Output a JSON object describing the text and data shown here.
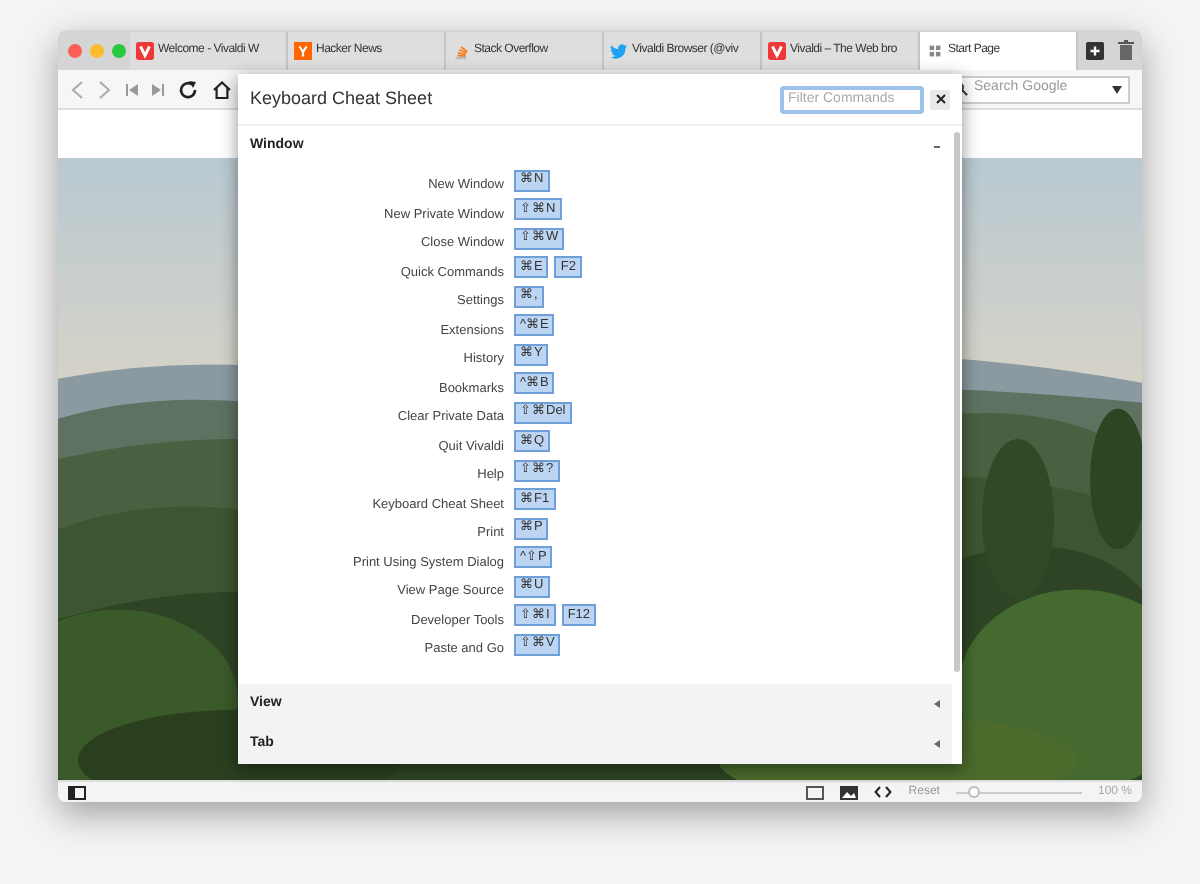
{
  "tabs": [
    {
      "title": "Welcome - Vivaldi W",
      "kind": "vivaldi",
      "selected": false
    },
    {
      "title": "Hacker News",
      "kind": "hn",
      "selected": false
    },
    {
      "title": "Stack Overflow",
      "kind": "stack",
      "selected": false
    },
    {
      "title": "Vivaldi Browser (@viv",
      "kind": "bird",
      "selected": false
    },
    {
      "title": "Vivaldi – The Web bro",
      "kind": "vivaldi",
      "selected": false
    },
    {
      "title": "Start Page",
      "kind": "grid",
      "selected": true
    }
  ],
  "search": {
    "placeholder": "Search Google"
  },
  "dialog": {
    "title": "Keyboard Cheat Sheet",
    "filter": {
      "placeholder": "Filter Commands"
    },
    "sections": [
      {
        "name": "Window",
        "expanded": true,
        "shortcuts": [
          {
            "label": "New Window",
            "keys": [
              "⌘N"
            ]
          },
          {
            "label": "New Private Window",
            "keys": [
              "⇧⌘N"
            ]
          },
          {
            "label": "Close Window",
            "keys": [
              "⇧⌘W"
            ]
          },
          {
            "label": "Quick Commands",
            "keys": [
              "⌘E",
              "F2"
            ]
          },
          {
            "label": "Settings",
            "keys": [
              "⌘,"
            ]
          },
          {
            "label": "Extensions",
            "keys": [
              "^⌘E"
            ]
          },
          {
            "label": "History",
            "keys": [
              "⌘Y"
            ]
          },
          {
            "label": "Bookmarks",
            "keys": [
              "^⌘B"
            ]
          },
          {
            "label": "Clear Private Data",
            "keys": [
              "⇧⌘Del"
            ]
          },
          {
            "label": "Quit Vivaldi",
            "keys": [
              "⌘Q"
            ]
          },
          {
            "label": "Help",
            "keys": [
              "⇧⌘?"
            ]
          },
          {
            "label": "Keyboard Cheat Sheet",
            "keys": [
              "⌘F1"
            ]
          },
          {
            "label": "Print",
            "keys": [
              "⌘P"
            ]
          },
          {
            "label": "Print Using System Dialog",
            "keys": [
              "^⇧P"
            ]
          },
          {
            "label": "View Page Source",
            "keys": [
              "⌘U"
            ]
          },
          {
            "label": "Developer Tools",
            "keys": [
              "⇧⌘I",
              "F12"
            ]
          },
          {
            "label": "Paste and Go",
            "keys": [
              "⇧⌘V"
            ]
          }
        ]
      },
      {
        "name": "View",
        "expanded": false
      },
      {
        "name": "Tab",
        "expanded": false
      }
    ]
  },
  "status_bar": {
    "reset": "Reset",
    "zoom": {
      "level": 0.15,
      "reading": "100 %"
    }
  }
}
